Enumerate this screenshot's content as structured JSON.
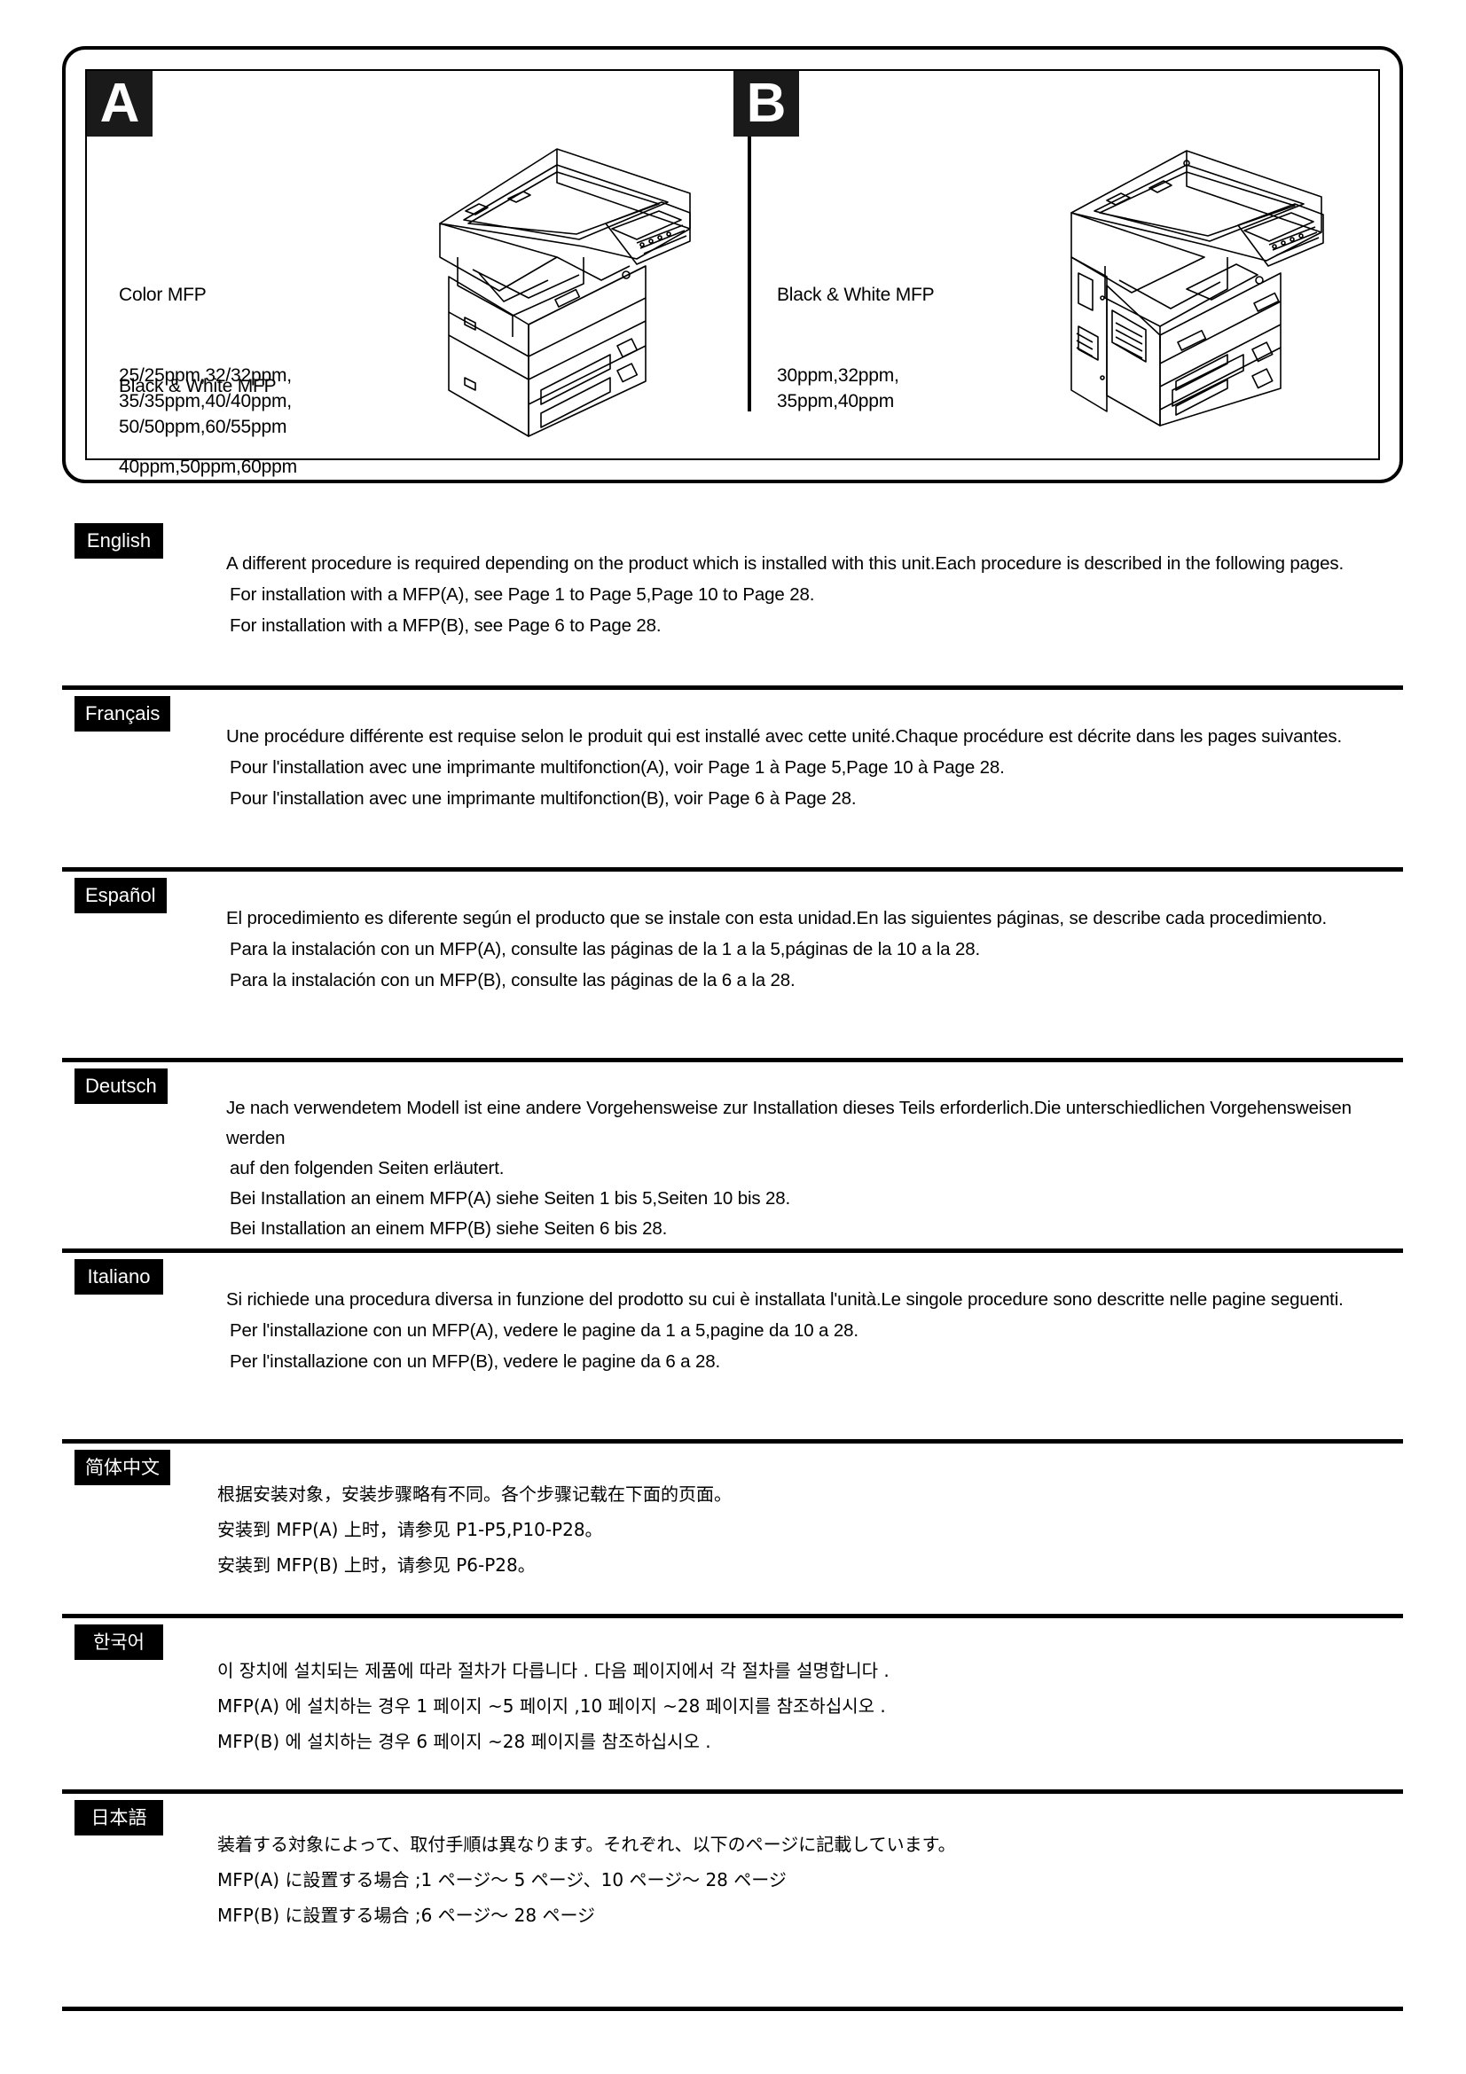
{
  "hero": {
    "panel_a": {
      "tag": "A",
      "color_mfp_title": "Color MFP",
      "color_mfp_specs": "25/25ppm,32/32ppm,\n35/35ppm,40/40ppm,\n50/50ppm,60/55ppm",
      "bw_mfp_title": "Black & White MFP",
      "bw_mfp_specs": "40ppm,50ppm,60ppm",
      "printer_icon": "color-mfp-illustration"
    },
    "panel_b": {
      "tag": "B",
      "bw_mfp_title": "Black & White MFP",
      "bw_mfp_specs": "30ppm,32ppm,\n35ppm,40ppm",
      "printer_icon": "black-white-mfp-illustration"
    }
  },
  "languages": [
    {
      "badge": "English",
      "line1": "A different procedure is required depending on the product which is installed with this unit.Each procedure is described in the following pages.",
      "line2": "For installation with a MFP(A), see Page 1 to Page 5,Page 10 to Page 28.",
      "line3": "For installation with a MFP(B), see Page 6 to Page 28.",
      "line4": ""
    },
    {
      "badge": "Français",
      "line1": "Une procédure différente est requise selon le produit qui est installé avec cette unité.Chaque procédure est décrite dans les pages suivantes.",
      "line2": "Pour l'installation avec une imprimante multifonction(A), voir Page 1 à Page 5,Page 10 à Page 28.",
      "line3": "Pour l'installation avec une imprimante multifonction(B), voir Page 6 à Page 28.",
      "line4": ""
    },
    {
      "badge": "Español",
      "line1": "El procedimiento es diferente según el producto que se instale con esta unidad.En las siguientes páginas, se describe cada procedimiento.",
      "line2": "Para la instalación con un MFP(A), consulte las páginas de la 1 a la 5,páginas de la 10 a la 28.",
      "line3": "Para la instalación con un MFP(B), consulte las páginas de la 6 a la 28.",
      "line4": ""
    },
    {
      "badge": "Deutsch",
      "line1": "Je nach verwendetem Modell ist eine andere Vorgehensweise zur Installation dieses Teils erforderlich.Die unterschiedlichen Vorgehensweisen werden",
      "line2": "auf den folgenden Seiten erläutert.",
      "line3": "Bei Installation an einem MFP(A) siehe Seiten 1 bis 5,Seiten 10 bis 28.",
      "line4": "Bei Installation an einem MFP(B) siehe Seiten 6 bis 28."
    },
    {
      "badge": "Italiano",
      "line1": "Si richiede una procedura diversa in funzione del prodotto su cui è installata l'unità.Le singole procedure sono descritte nelle pagine seguenti.",
      "line2": "Per l'installazione con un MFP(A), vedere le pagine da 1 a 5,pagine da 10 a 28.",
      "line3": "Per l'installazione con un MFP(B), vedere le pagine da 6 a 28.",
      "line4": ""
    },
    {
      "badge": "简体中文",
      "line1": "根据安装对象，安装步骤略有不同。各个步骤记载在下面的页面。",
      "line2": "安装到 MFP(A) 上时，请参见 P1-P5,P10-P28。",
      "line3": "安装到 MFP(B) 上时，请参见 P6-P28。",
      "line4": ""
    },
    {
      "badge": "한국어",
      "line1": "이 장치에 설치되는 제품에 따라 절차가 다릅니다 . 다음 페이지에서 각 절차를 설명합니다 .",
      "line2": "MFP(A) 에 설치하는 경우 1 페이지 ~5 페이지 ,10 페이지 ~28 페이지를 참조하십시오 .",
      "line3": "MFP(B) 에 설치하는 경우 6 페이지 ~28 페이지를 참조하십시오 .",
      "line4": ""
    },
    {
      "badge": "日本語",
      "line1": "装着する対象によって、取付手順は異なります。それぞれ、以下のページに記載しています。",
      "line2": "MFP(A) に設置する場合 ;1 ページ～ 5 ページ、10 ページ～ 28 ページ",
      "line3": "MFP(B) に設置する場合 ;6 ページ～ 28 ページ",
      "line4": ""
    }
  ],
  "colors": {
    "ink": "#000000",
    "paper": "#ffffff",
    "badge_background": "#000000",
    "badge_text": "#ffffff"
  }
}
